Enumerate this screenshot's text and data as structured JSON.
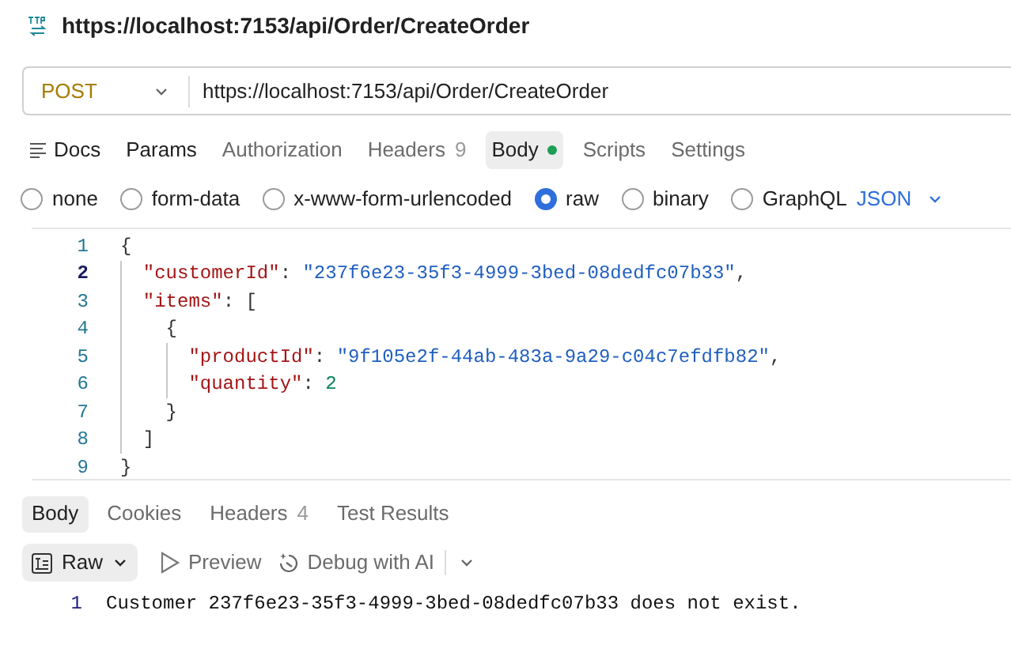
{
  "request_title": "https://localhost:7153/api/Order/CreateOrder",
  "url_bar": {
    "method": "POST",
    "url": "https://localhost:7153/api/Order/CreateOrder"
  },
  "request_tabs": [
    {
      "label": "Docs",
      "kind": "docs",
      "selected": false
    },
    {
      "label": "Params",
      "kind": "plain",
      "selected": false
    },
    {
      "label": "Authorization",
      "kind": "plain",
      "selected": false
    },
    {
      "label": "Headers",
      "count": "9",
      "kind": "plain",
      "selected": false
    },
    {
      "label": "Body",
      "kind": "dot",
      "selected": true
    },
    {
      "label": "Scripts",
      "kind": "plain",
      "selected": false
    },
    {
      "label": "Settings",
      "kind": "plain",
      "selected": false
    }
  ],
  "body_types": [
    {
      "label": "none",
      "selected": false
    },
    {
      "label": "form-data",
      "selected": false
    },
    {
      "label": "x-www-form-urlencoded",
      "selected": false
    },
    {
      "label": "raw",
      "selected": true
    },
    {
      "label": "binary",
      "selected": false
    },
    {
      "label": "GraphQL",
      "selected": false
    }
  ],
  "language": "JSON",
  "editor_lines": [
    {
      "number": "1",
      "active": false,
      "tokens": [
        {
          "kind": "punct",
          "text": "{"
        }
      ]
    },
    {
      "number": "2",
      "active": true,
      "tokens": [
        {
          "kind": "key",
          "text": "  \"customerId\""
        },
        {
          "kind": "punct",
          "text": ": "
        },
        {
          "kind": "string",
          "text": "\"237f6e23-35f3-4999-3bed-08dedfc07b33\""
        },
        {
          "kind": "punct",
          "text": ","
        }
      ]
    },
    {
      "number": "3",
      "active": false,
      "tokens": [
        {
          "kind": "key",
          "text": "  \"items\""
        },
        {
          "kind": "punct",
          "text": ": ["
        }
      ]
    },
    {
      "number": "4",
      "active": false,
      "tokens": [
        {
          "kind": "punct",
          "text": "    {"
        }
      ]
    },
    {
      "number": "5",
      "active": false,
      "tokens": [
        {
          "kind": "key",
          "text": "      \"productId\""
        },
        {
          "kind": "punct",
          "text": ": "
        },
        {
          "kind": "string",
          "text": "\"9f105e2f-44ab-483a-9a29-c04c7efdfb82\""
        },
        {
          "kind": "punct",
          "text": ","
        }
      ]
    },
    {
      "number": "6",
      "active": false,
      "tokens": [
        {
          "kind": "key",
          "text": "      \"quantity\""
        },
        {
          "kind": "punct",
          "text": ": "
        },
        {
          "kind": "number",
          "text": "2"
        }
      ]
    },
    {
      "number": "7",
      "active": false,
      "tokens": [
        {
          "kind": "punct",
          "text": "    }"
        }
      ]
    },
    {
      "number": "8",
      "active": false,
      "tokens": [
        {
          "kind": "punct",
          "text": "  ]"
        }
      ]
    },
    {
      "number": "9",
      "active": false,
      "tokens": [
        {
          "kind": "punct",
          "text": "}"
        }
      ]
    }
  ],
  "response_tabs": [
    {
      "label": "Body",
      "selected": true
    },
    {
      "label": "Cookies",
      "selected": false
    },
    {
      "label": "Headers",
      "count": "4",
      "selected": false
    },
    {
      "label": "Test Results",
      "selected": false
    }
  ],
  "response_toolbar": {
    "format": "Raw",
    "preview": "Preview",
    "debug": "Debug with AI"
  },
  "response_lines": [
    {
      "number": "1",
      "text": "Customer 237f6e23-35f3-4999-3bed-08dedfc07b33 does not exist."
    }
  ]
}
